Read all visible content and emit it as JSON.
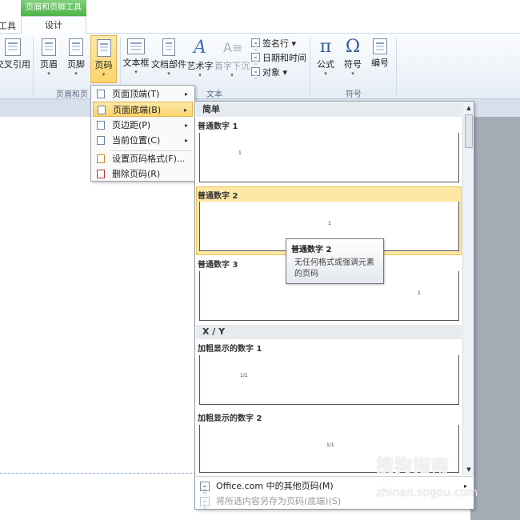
{
  "context_tab": {
    "header": "页眉和页脚工具",
    "design_tab": "设计",
    "left_fragment": "工具"
  },
  "ribbon": {
    "cross_ref": "交叉引用",
    "header_btn": "页眉",
    "footer_btn": "页脚",
    "page_number_btn": "页码",
    "textbox_btn": "文本框",
    "docparts_btn": "文档部件",
    "wordart_btn": "艺术字",
    "dropcap_btn": "首字下沉",
    "signature_line": "签名行",
    "datetime": "日期和时间",
    "object": "对象",
    "equation": "公式",
    "symbol": "符号",
    "numbering": "编号",
    "group_header_footer": "页眉和页",
    "group_text": "文本",
    "group_symbols": "符号"
  },
  "page_number_menu": {
    "items": [
      {
        "label": "页面顶端(T)",
        "has_arrow": true
      },
      {
        "label": "页面底端(B)",
        "has_arrow": true,
        "highlighted": true
      },
      {
        "label": "页边距(P)",
        "has_arrow": true
      },
      {
        "label": "当前位置(C)",
        "has_arrow": true
      },
      {
        "label": "设置页码格式(F)..."
      },
      {
        "label": "删除页码(R)"
      }
    ]
  },
  "gallery": {
    "section_simple": "简单",
    "section_xy": "X / Y",
    "items": [
      {
        "label": "普通数字 1",
        "sample": "1"
      },
      {
        "label": "普通数字 2",
        "sample": "1",
        "highlighted": true
      },
      {
        "label": "普通数字 3",
        "sample": "1"
      },
      {
        "label": "加粗显示的数字 1",
        "sample": "1/1"
      },
      {
        "label": "加粗显示的数字 2",
        "sample": "1/1"
      }
    ],
    "footer_more": "Office.com 中的其他页码(M)",
    "footer_save": "将所选内容另存为页码(底端)(S)"
  },
  "tooltip": {
    "title": "普通数字 2",
    "description_line1": "无任何格式或强调元素",
    "description_line2": "的页码"
  },
  "watermark": {
    "text": "搜狗指南",
    "sub": "zhinan.sogou.com"
  },
  "colors": {
    "accent_green": "#4fb34a",
    "highlight": "#fbd46b",
    "gallery_header": "#e7ebf0"
  }
}
